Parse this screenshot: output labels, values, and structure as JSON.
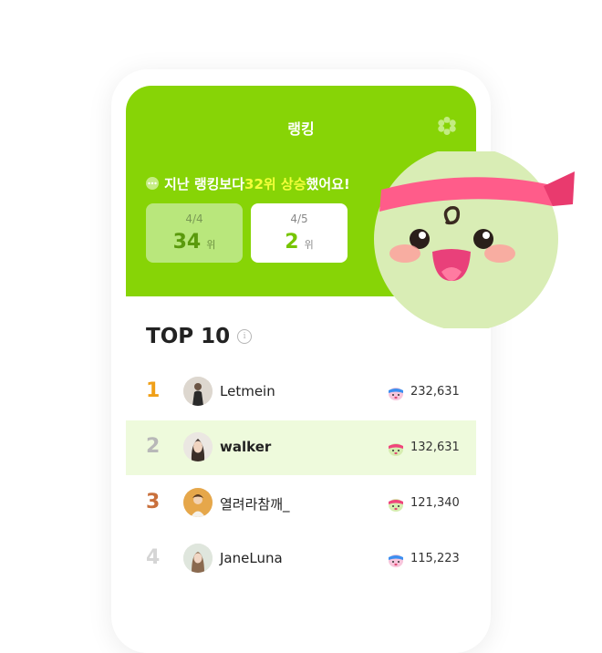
{
  "header": {
    "title": "랭킹",
    "notice_prefix": "지난 랭킹보다 ",
    "notice_highlight": "32위 상승",
    "notice_suffix": "했어요!"
  },
  "rank_previous": {
    "date": "4/4",
    "value": "34",
    "unit": "위"
  },
  "rank_current": {
    "date": "4/5",
    "value": "2",
    "unit": "위"
  },
  "top10": {
    "title": "TOP 10",
    "info_symbol": "i"
  },
  "leaderboard": [
    {
      "rank": "1",
      "name": "Letmein",
      "score": "232,631"
    },
    {
      "rank": "2",
      "name": "walker",
      "score": "132,631"
    },
    {
      "rank": "3",
      "name": "열려라참깨_",
      "score": "121,340"
    },
    {
      "rank": "4",
      "name": "JaneLuna",
      "score": "115,223"
    }
  ],
  "colors": {
    "accent_green": "#87d406",
    "highlight_yellow": "#f4ff3a",
    "rank_gold": "#f0a018",
    "rank_silver": "#b8b8b8",
    "rank_bronze": "#c9703c",
    "row_highlight": "#eefadc"
  },
  "icons": {
    "settings": "flower-gear-icon",
    "notice": "speech-dots-icon",
    "score": "mascot-face-icon",
    "info": "info-icon"
  }
}
